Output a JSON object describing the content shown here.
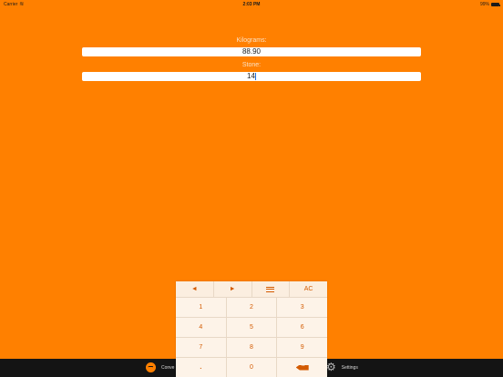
{
  "status": {
    "carrier": "Carrier",
    "time": "2:03 PM",
    "battery": "99%",
    "battery_level": 0.99
  },
  "fields": [
    {
      "label": "Kilograms:",
      "value": "88.90"
    },
    {
      "label": "Stone:",
      "value": "14"
    }
  ],
  "keypad": {
    "left_arrow": "◄",
    "right_arrow": "►",
    "clear": "AC",
    "rows": [
      [
        "1",
        "2",
        "3"
      ],
      [
        "4",
        "5",
        "6"
      ],
      [
        "7",
        "8",
        "9"
      ]
    ],
    "decimal": ".",
    "zero": "0"
  },
  "tabbar": {
    "convert_label": "Conve",
    "settings_label": "Settings"
  }
}
